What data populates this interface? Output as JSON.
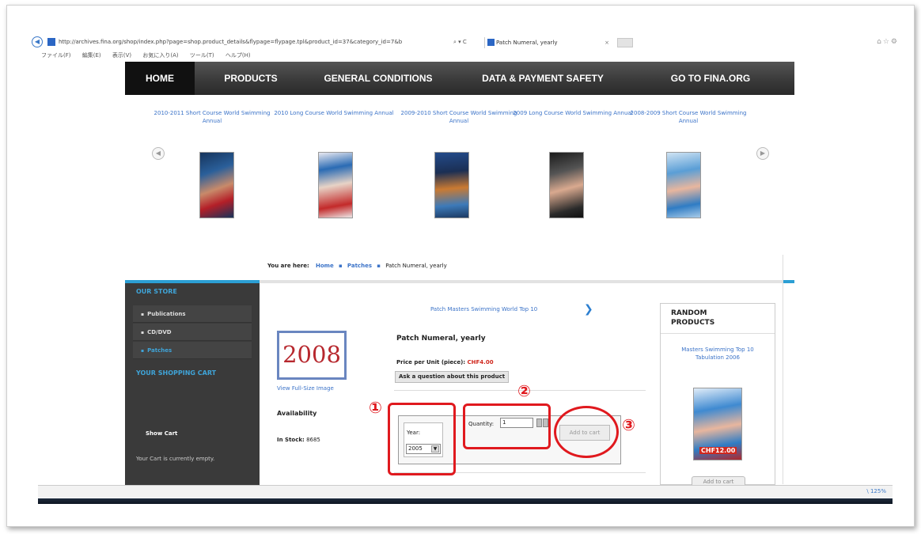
{
  "browser": {
    "url": "http://archives.fina.org/shop/index.php?page=shop.product_details&flypage=flypage.tpl&product_id=37&category_id=7&b",
    "addr_controls": "⌕ ▾ C",
    "tab_title": "Patch Numeral, yearly",
    "menu": [
      "ファイル(F)",
      "編集(E)",
      "表示(V)",
      "お気に入り(A)",
      "ツール(T)",
      "ヘルプ(H)"
    ],
    "zoom": "\\ 125%"
  },
  "nav": {
    "items": [
      "HOME",
      "PRODUCTS",
      "GENERAL CONDITIONS",
      "DATA & PAYMENT SAFETY",
      "GO TO FINA.ORG"
    ]
  },
  "carousel": {
    "titles": [
      "2010-2011 Short Course World Swimming Annual",
      "2010 Long Course World Swimming Annual",
      "2009-2010 Short Course World Swimming Annual",
      "2009 Long Course World Swimming Annual",
      "2008-2009 Short Course World Swimming Annual"
    ],
    "prev": "◀",
    "next": "▶"
  },
  "breadcrumb": {
    "label": "You are here:",
    "home": "Home",
    "sep": "▪",
    "category": "Patches",
    "current": "Patch Numeral, yearly"
  },
  "sidebar": {
    "store_title": "OUR STORE",
    "items": [
      "Publications",
      "CD/DVD",
      "Patches"
    ],
    "cart_title": "YOUR SHOPPING CART",
    "show_cart": "Show Cart",
    "cart_empty": "Your Cart is currently empty."
  },
  "product": {
    "next_link": "Patch Masters Swimming World Top 10",
    "next_arrow": "❯",
    "thumb_text": "2008",
    "view_full": "View Full-Size Image",
    "title": "Patch Numeral, yearly",
    "price_label": "Price per Unit (piece):",
    "price_value": "CHF4.00",
    "ask": "Ask a question about this product",
    "availability": "Availability",
    "in_stock_label": "In Stock:",
    "in_stock_value": "8685",
    "year_label": "Year:",
    "year_value": "2005",
    "quantity_label": "Quantity:",
    "quantity_value": "1",
    "add_to_cart": "Add to cart"
  },
  "random": {
    "title": "RANDOM PRODUCTS",
    "link": "Masters Swimming Top 10 Tabulation 2006",
    "price": "CHF12.00",
    "add_to_cart": "Add to cart"
  },
  "annotations": {
    "n1": "①",
    "n2": "②",
    "n3": "③",
    "color": "#e0191e"
  }
}
